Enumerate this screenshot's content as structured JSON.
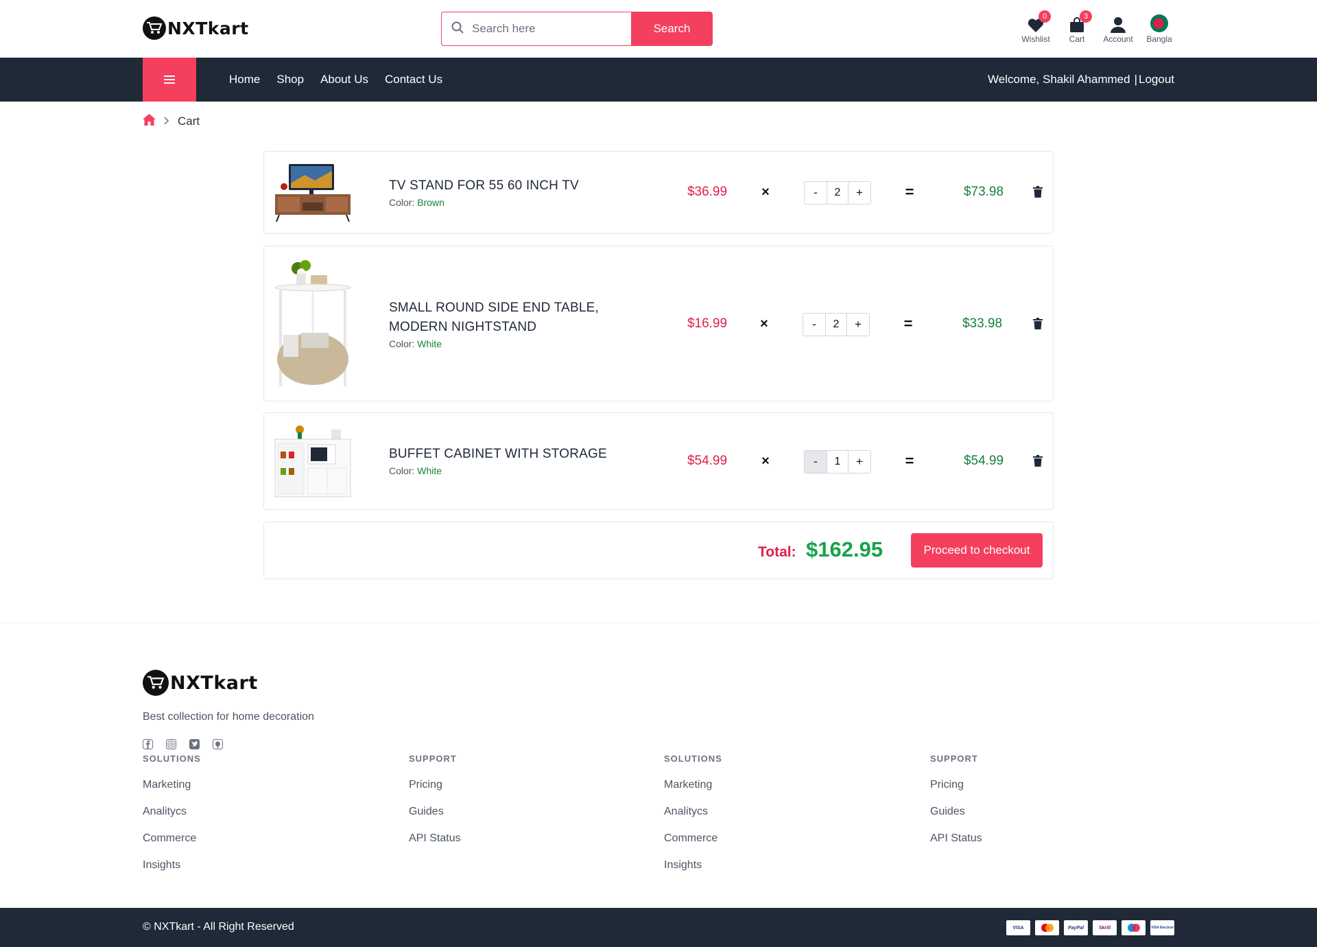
{
  "header": {
    "brand": "NXTkart",
    "search": {
      "placeholder": "Search here",
      "button": "Search"
    },
    "icons": [
      {
        "label": "Wishlist",
        "icon": "heart-icon",
        "badge": "0"
      },
      {
        "label": "Cart",
        "icon": "bag-icon",
        "badge": "3"
      },
      {
        "label": "Account",
        "icon": "user-icon"
      },
      {
        "label": "Bangla",
        "icon": "bangladesh-flag-icon"
      }
    ]
  },
  "nav": {
    "menu_icon": "menu-icon",
    "links": [
      "Home",
      "Shop",
      "About Us",
      "Contact Us"
    ],
    "welcome": "Welcome, Shakil Ahammed",
    "logout": "Logout"
  },
  "breadcrumb": {
    "home_icon": "home-icon",
    "current": "Cart"
  },
  "cart": {
    "items": [
      {
        "title": "TV STAND FOR 55 60 INCH TV",
        "color_label": "Color:",
        "color": "Brown",
        "price": "$36.99",
        "times": "×",
        "quantity": "2",
        "minus": "-",
        "plus": "+",
        "equals": "=",
        "subtotal": "$73.98"
      },
      {
        "title": "SMALL ROUND SIDE END TABLE, MODERN NIGHTSTAND",
        "color_label": "Color:",
        "color": "White",
        "price": "$16.99",
        "times": "×",
        "quantity": "2",
        "minus": "-",
        "plus": "+",
        "equals": "=",
        "subtotal": "$33.98"
      },
      {
        "title": "BUFFET CABINET WITH STORAGE",
        "color_label": "Color:",
        "color": "White",
        "price": "$54.99",
        "times": "×",
        "quantity": "1",
        "minus": "-",
        "plus": "+",
        "equals": "=",
        "subtotal": "$54.99"
      }
    ],
    "total_label": "Total:",
    "total_value": "$162.95",
    "checkout": "Proceed to checkout"
  },
  "footer": {
    "brand": "NXTkart",
    "tagline": "Best collection for home decoration",
    "socials": [
      "facebook-icon",
      "instagram-icon",
      "twitter-icon",
      "github-icon"
    ],
    "columns": [
      {
        "heading": "SOLUTIONS",
        "links": [
          "Marketing",
          "Analitycs",
          "Commerce",
          "Insights"
        ]
      },
      {
        "heading": "SUPPORT",
        "links": [
          "Pricing",
          "Guides",
          "API Status"
        ]
      },
      {
        "heading": "SOLUTIONS",
        "links": [
          "Marketing",
          "Analitycs",
          "Commerce",
          "Insights"
        ]
      },
      {
        "heading": "SUPPORT",
        "links": [
          "Pricing",
          "Guides",
          "API Status"
        ]
      }
    ],
    "copyright": "© NXTkart - All Right Reserved",
    "payment_methods": [
      "VISA",
      "MC",
      "PayPal",
      "Skrill",
      "Maestro",
      "VISA Electron"
    ]
  },
  "colors": {
    "accent": "#f43f5e",
    "dark": "#1f2937",
    "green": "#16a34a"
  }
}
